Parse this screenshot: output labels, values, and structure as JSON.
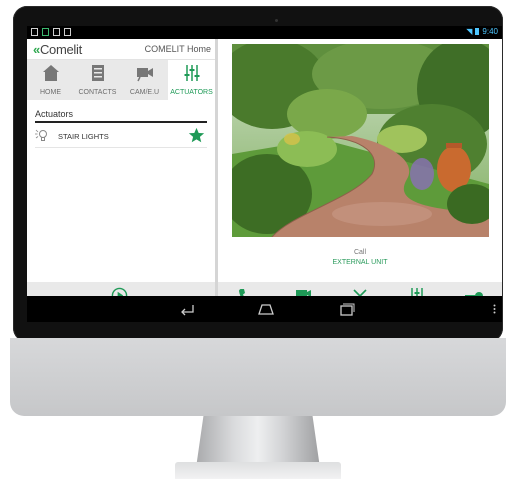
{
  "brand": {
    "logo_text": "Comelit",
    "home_title": "COMELIT Home"
  },
  "statusbar": {
    "time": "9:40"
  },
  "nav": {
    "items": [
      {
        "label": "HOME",
        "icon": "house-icon"
      },
      {
        "label": "CONTACTS",
        "icon": "contacts-list-icon"
      },
      {
        "label": "CAM/E.U",
        "icon": "camera-icon"
      },
      {
        "label": "ACTUATORS",
        "icon": "sliders-icon",
        "active": true
      }
    ]
  },
  "actuators": {
    "section_title": "Actuators",
    "items": [
      {
        "label": "STAIR LIGHTS",
        "icon": "bulb-icon",
        "favorite": true
      }
    ]
  },
  "call": {
    "title": "Call",
    "subtitle": "EXTERNAL UNIT"
  },
  "call_controls": [
    "answer-call",
    "swap-camera",
    "hang-up",
    "actuators",
    "open-door-key"
  ],
  "colors": {
    "accent": "#1f9a57",
    "bar_bg": "#e9e9e9"
  }
}
